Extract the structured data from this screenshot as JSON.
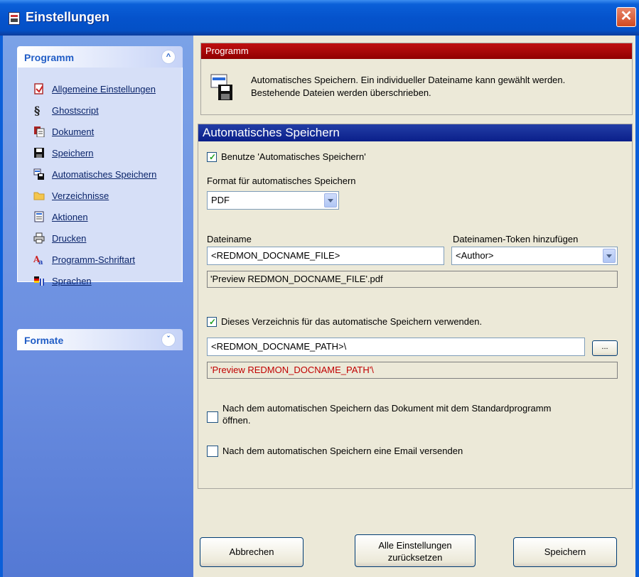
{
  "window": {
    "title": "Einstellungen",
    "close_glyph": "✕"
  },
  "sidebar": {
    "programm": {
      "title": "Programm",
      "chevron": "⌃",
      "items": [
        {
          "label": "Allgemeine Einstellungen",
          "icon": "general-settings-icon"
        },
        {
          "label": "Ghostscript",
          "icon": "ghostscript-icon"
        },
        {
          "label": "Dokument",
          "icon": "document-icon"
        },
        {
          "label": "Speichern",
          "icon": "save-icon"
        },
        {
          "label": "Automatisches Speichern",
          "icon": "autosave-icon"
        },
        {
          "label": "Verzeichnisse",
          "icon": "folder-icon"
        },
        {
          "label": "Aktionen",
          "icon": "actions-icon"
        },
        {
          "label": "Drucken",
          "icon": "printer-icon"
        },
        {
          "label": "Programm-Schriftart",
          "icon": "font-icon"
        },
        {
          "label": "Sprachen",
          "icon": "languages-icon"
        }
      ]
    },
    "formate": {
      "title": "Formate",
      "chevron": "⌄"
    }
  },
  "programm_box": {
    "header": "Programm",
    "description_line1": "Automatisches Speichern. Ein individueller Dateiname kann gewählt werden.",
    "description_line2": "Bestehende Dateien werden überschrieben."
  },
  "autosave": {
    "header": "Automatisches Speichern",
    "use_autosave_label": "Benutze 'Automatisches Speichern'",
    "use_autosave_checked": true,
    "format_label": "Format für automatisches Speichern",
    "format_value": "PDF",
    "filename_label": "Dateiname",
    "filename_value": "<REDMON_DOCNAME_FILE>",
    "token_label": "Dateinamen-Token hinzufügen",
    "token_value": "<Author>",
    "filename_preview": "'Preview REDMON_DOCNAME_FILE'.pdf",
    "use_dir_label": "Dieses Verzeichnis für das automatische Speichern verwenden.",
    "use_dir_checked": true,
    "dir_value": "<REDMON_DOCNAME_PATH>\\",
    "browse_label": "...",
    "dir_preview": "'Preview REDMON_DOCNAME_PATH'\\",
    "open_after_label_line1": "Nach dem automatischen Speichern das Dokument mit dem Standardprogramm",
    "open_after_label_line2": "öffnen.",
    "open_after_checked": false,
    "send_email_label": "Nach dem automatischen Speichern eine Email versenden",
    "send_email_checked": false
  },
  "buttons": {
    "cancel": "Abbrechen",
    "reset_line1": "Alle Einstellungen",
    "reset_line2": "zurücksetzen",
    "save": "Speichern"
  },
  "colors": {
    "titlebar": "#0553cc",
    "red_header": "#b00000",
    "blue_header": "#1a2f9a",
    "sidebar": "#6b8ee0",
    "preview_red_text": "#c00000",
    "check_green": "#21a121"
  }
}
